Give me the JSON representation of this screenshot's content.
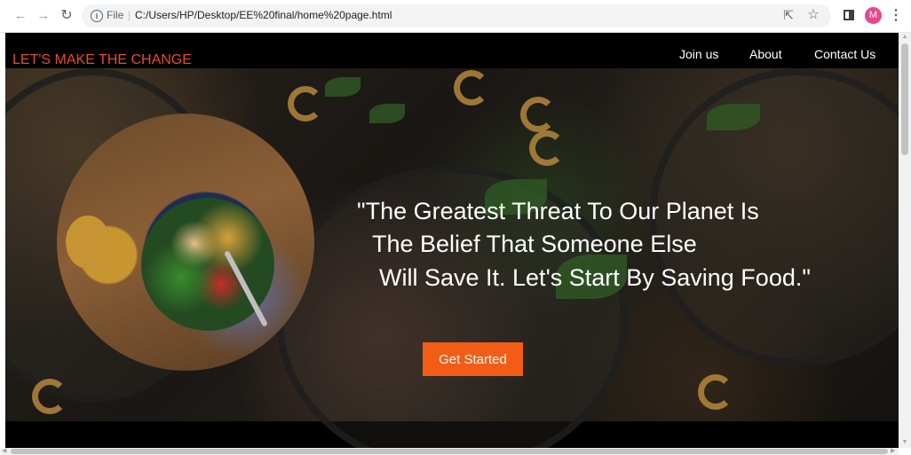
{
  "browser": {
    "back_icon": "arrow-left-icon",
    "forward_icon": "arrow-right-icon",
    "reload_icon": "reload-icon",
    "info_icon": "info-icon",
    "scheme": "File",
    "url": "C:/Users/HP/Desktop/EE%20final/home%20page.html",
    "share_icon": "share-icon",
    "star_icon": "star-icon",
    "side_panel_icon": "side-panel-icon",
    "avatar_letter": "M",
    "avatar_color": "#e8468e",
    "menu_icon": "kebab-menu-icon"
  },
  "site": {
    "brand": "LET'S MAKE THE CHANGE",
    "brand_color": "#e74b2d",
    "nav": {
      "join": "Join us",
      "about": "About",
      "contact": "Contact Us"
    },
    "quote_lines": [
      "\"The Greatest Threat To Our Planet Is",
      "The Belief That Someone Else",
      "Will Save It. Let's Start By Saving Food.\""
    ],
    "cta_label": "Get Started",
    "cta_color": "#f25c16"
  }
}
